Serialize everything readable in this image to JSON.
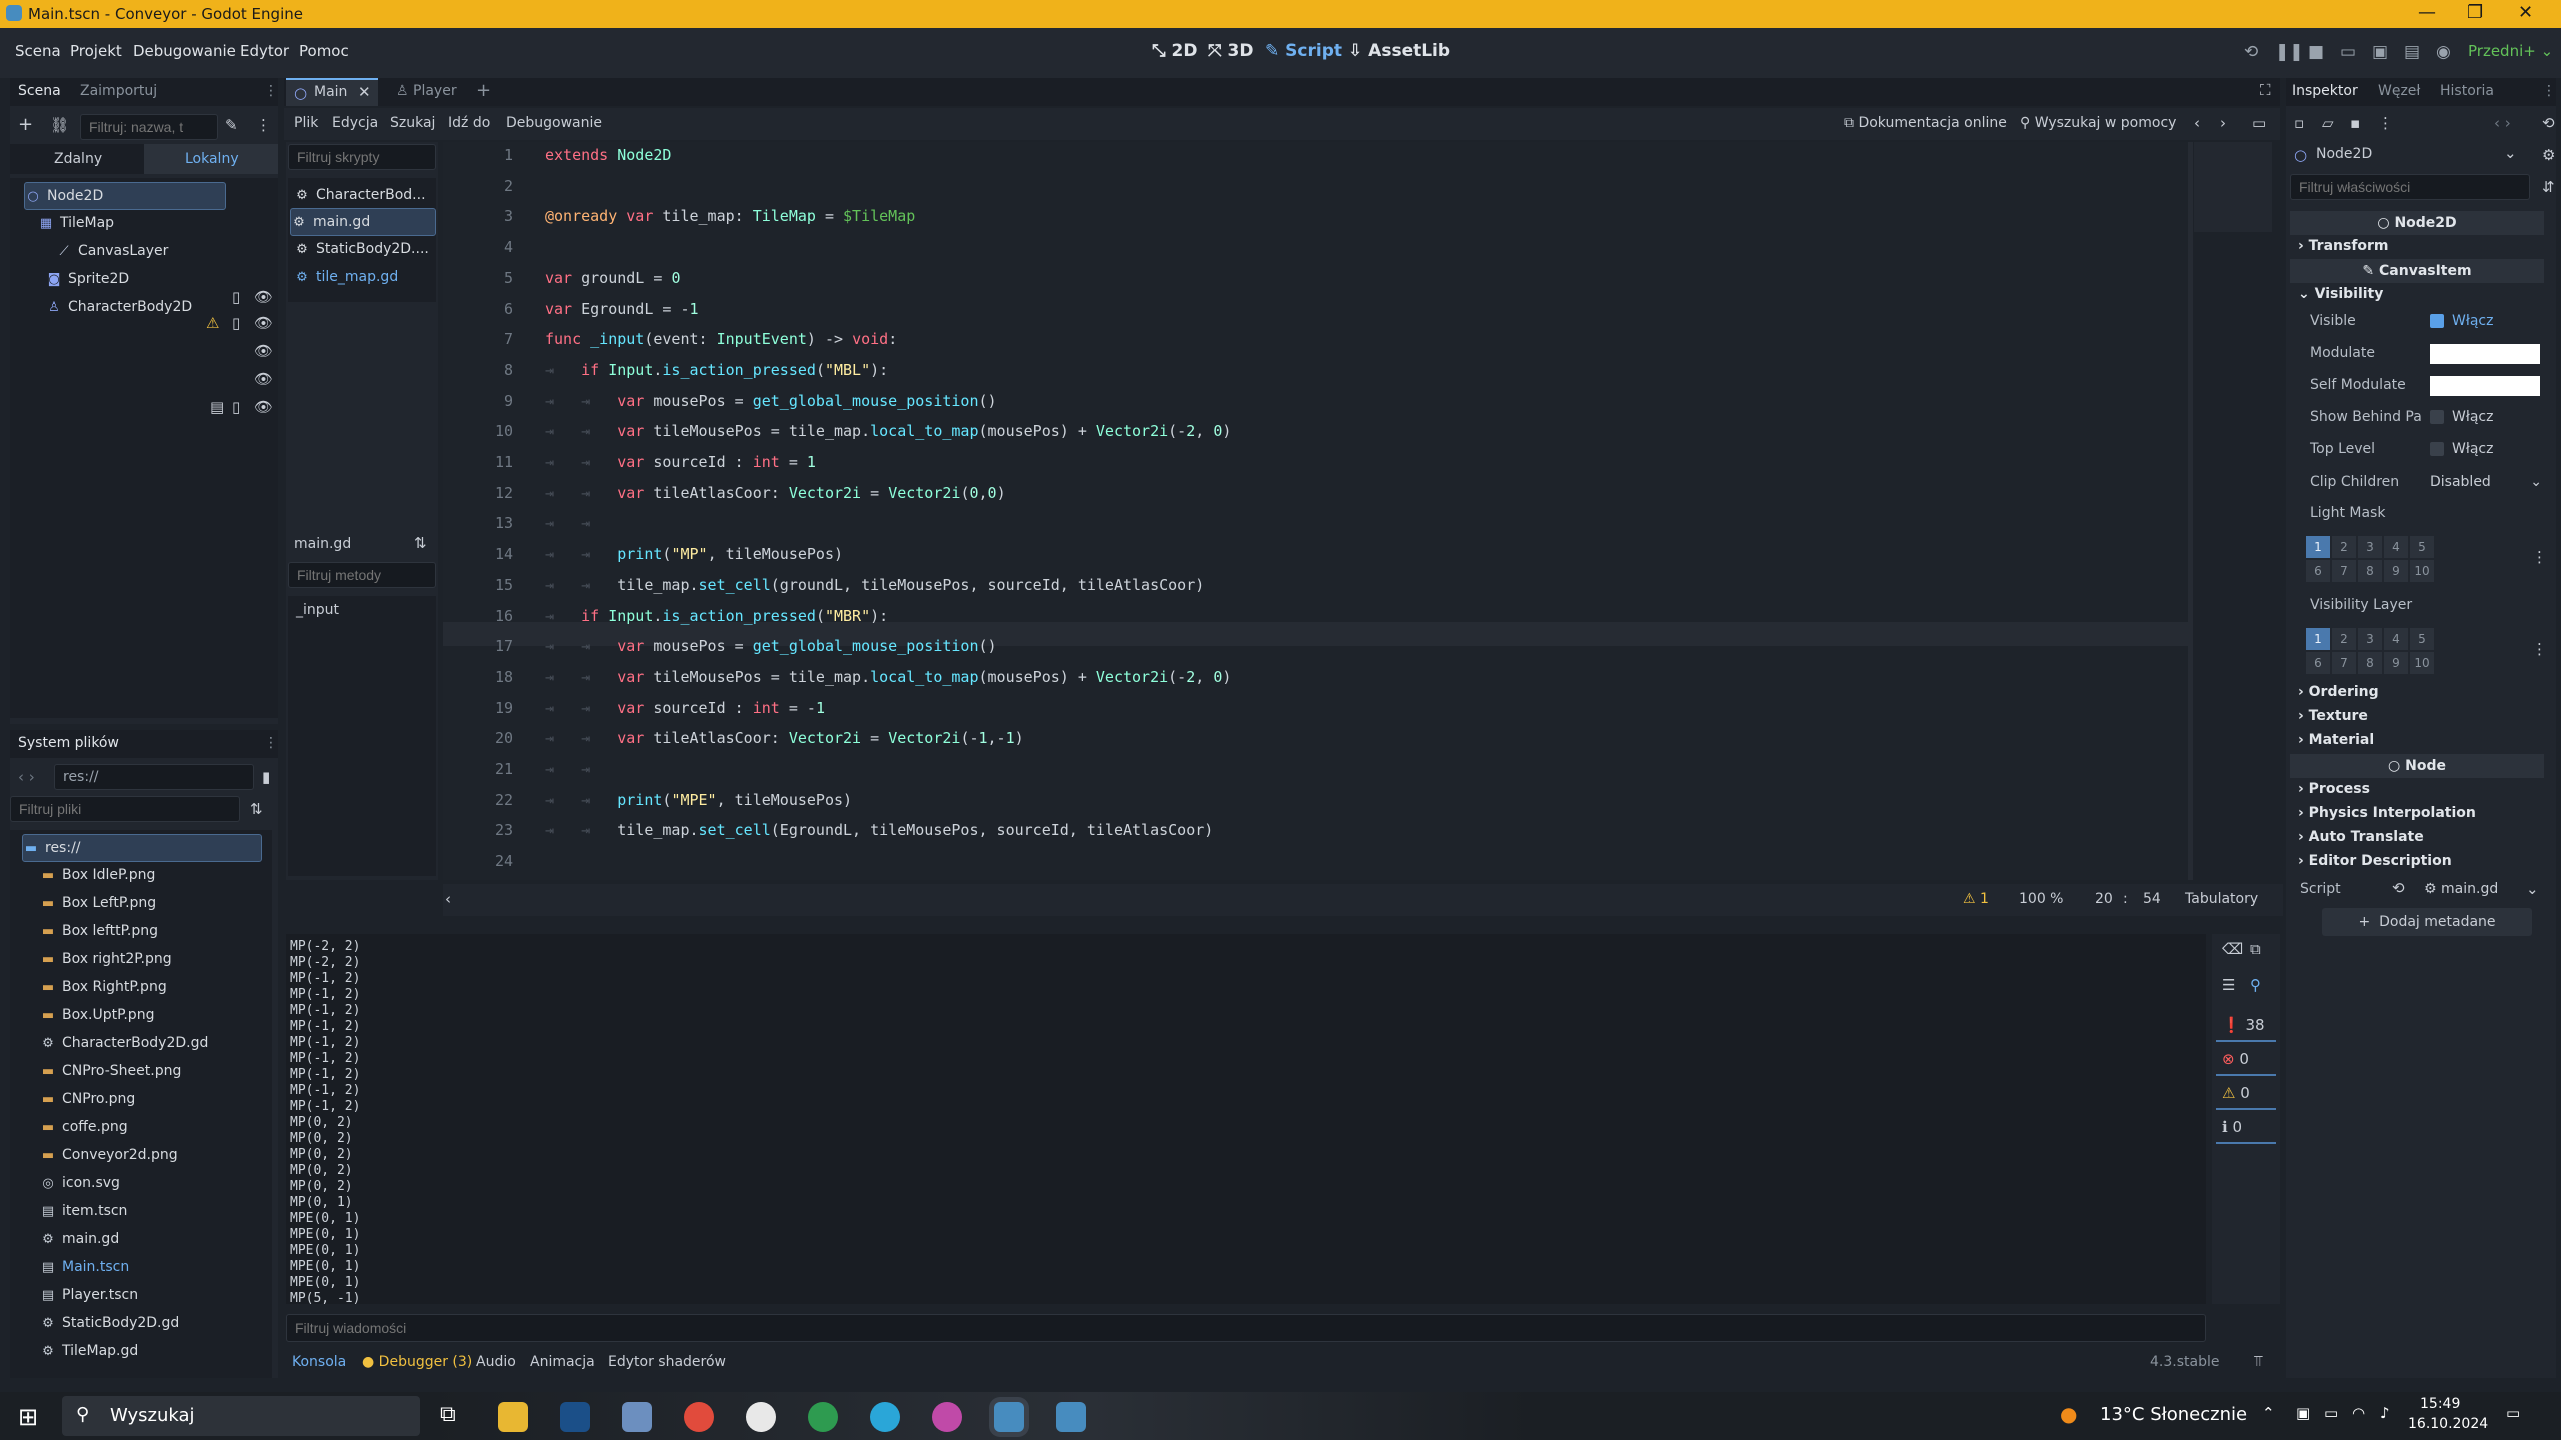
{
  "window": {
    "title": "Main.tscn - Conveyor - Godot Engine",
    "controls": [
      "—",
      "❐",
      "✕"
    ]
  },
  "menu": {
    "items": [
      "Scena",
      "Projekt",
      "Debugowanie",
      "Edytor",
      "Pomoc"
    ],
    "workspaces": [
      "2D",
      "3D",
      "Script",
      "AssetLib"
    ],
    "renderer": "Przedni+"
  },
  "scene_dock": {
    "tabs": [
      "Scena",
      "Zaimportuj"
    ],
    "filter_placeholder": "Filtruj: nazwa, t",
    "subtabs": [
      "Zdalny",
      "Lokalny"
    ],
    "nodes": [
      "Node2D",
      "TileMap",
      "CanvasLayer",
      "Sprite2D",
      "CharacterBody2D"
    ]
  },
  "filesystem": {
    "tab": "System plików",
    "path": "res://",
    "filter_placeholder": "Filtruj pliki",
    "root": "res://",
    "files": [
      "Box IdleP.png",
      "Box LeftP.png",
      "Box lefttP.png",
      "Box right2P.png",
      "Box RightP.png",
      "Box.UptP.png",
      "CharacterBody2D.gd",
      "CNPro-Sheet.png",
      "CNPro.png",
      "coffe.png",
      "Conveyor2d.png",
      "icon.svg",
      "item.tscn",
      "main.gd",
      "Main.tscn",
      "Player.tscn",
      "StaticBody2D.gd",
      "TileMap.gd"
    ]
  },
  "editor_tabs": {
    "tabs": [
      "Main",
      "Player"
    ]
  },
  "script_menu": {
    "items": [
      "Plik",
      "Edycja",
      "Szukaj",
      "Idź do",
      "Debugowanie"
    ],
    "docs": "Dokumentacja online",
    "help": "Wyszukaj w pomocy"
  },
  "script_list": {
    "filter_placeholder": "Filtruj skrypty",
    "scripts": [
      "CharacterBod...",
      "main.gd",
      "StaticBody2D....",
      "tile_map.gd"
    ],
    "current": "main.gd",
    "method_filter": "Filtruj metody",
    "methods": [
      "_input"
    ]
  },
  "code": {
    "lines": [
      "extends Node2D",
      "",
      "@onready var tile_map: TileMap = $TileMap",
      "",
      "var groundL = 0",
      "var EgroundL = -1",
      "func _input(event: InputEvent) -> void:",
      "\tif Input.is_action_pressed(\"MBL\"):",
      "\t\tvar mousePos = get_global_mouse_position()",
      "\t\tvar tileMousePos = tile_map.local_to_map(mousePos) + Vector2i(-2, 0)",
      "\t\tvar sourceId : int = 1",
      "\t\tvar tileAtlasCoor: Vector2i = Vector2i(0,0)",
      "\t\t",
      "\t\tprint(\"MP\", tileMousePos)",
      "\t\ttile_map.set_cell(groundL, tileMousePos, sourceId, tileAtlasCoor)",
      "\tif Input.is_action_pressed(\"MBR\"):",
      "\t\tvar mousePos = get_global_mouse_position()",
      "\t\tvar tileMousePos = tile_map.local_to_map(mousePos) + Vector2i(-2, 0)",
      "\t\tvar sourceId : int = -1",
      "\t\tvar tileAtlasCoor: Vector2i = Vector2i(-1,-1)",
      "\t\t",
      "\t\tprint(\"MPE\", tileMousePos)",
      "\t\ttile_map.set_cell(EgroundL, tileMousePos, sourceId, tileAtlasCoor)",
      ""
    ]
  },
  "status": {
    "warnings": "1",
    "zoom": "100 %",
    "line": "20",
    "col": "54",
    "indent": "Tabulatory"
  },
  "output": {
    "lines": [
      "MP(-2, 2)",
      "MP(-2, 2)",
      "MP(-1, 2)",
      "MP(-1, 2)",
      "MP(-1, 2)",
      "MP(-1, 2)",
      "MP(-1, 2)",
      "MP(-1, 2)",
      "MP(-1, 2)",
      "MP(-1, 2)",
      "MP(-1, 2)",
      "MP(0, 2)",
      "MP(0, 2)",
      "MP(0, 2)",
      "MP(0, 2)",
      "MP(0, 2)",
      "MP(0, 1)",
      "MPE(0, 1)",
      "MPE(0, 1)",
      "MPE(0, 1)",
      "MPE(0, 1)",
      "MPE(0, 1)",
      "MP(5, -1)"
    ],
    "filter_placeholder": "Filtruj wiadomości",
    "counts": {
      "messages": "38",
      "errors": "0",
      "warnings": "0",
      "info": "0"
    }
  },
  "bottom_tabs": {
    "tabs": [
      "Konsola",
      "Debugger (3)",
      "Audio",
      "Animacja",
      "Edytor shaderów"
    ],
    "version": "4.3.stable"
  },
  "inspector": {
    "tabs": [
      "Inspektor",
      "Węzeł",
      "Historia"
    ],
    "node": "Node2D",
    "filter_placeholder": "Filtruj właściwości",
    "class1": "Node2D",
    "transform": "Transform",
    "class2": "CanvasItem",
    "visibility": "Visibility",
    "props": {
      "visible": "Visible",
      "visible_val": "Włącz",
      "modulate": "Modulate",
      "self_modulate": "Self Modulate",
      "show_behind": "Show Behind Pa",
      "show_behind_val": "Włącz",
      "top_level": "Top Level",
      "top_level_val": "Włącz",
      "clip_children": "Clip Children",
      "clip_val": "Disabled",
      "light_mask": "Light Mask",
      "vis_layer": "Visibility Layer"
    },
    "mask_bits": [
      "1",
      "2",
      "3",
      "4",
      "5",
      "6",
      "7",
      "8",
      "9",
      "10"
    ],
    "sections": [
      "Ordering",
      "Texture",
      "Material"
    ],
    "class3": "Node",
    "sections2": [
      "Process",
      "Physics Interpolation",
      "Auto Translate",
      "Editor Description"
    ],
    "script_label": "Script",
    "script_val": "main.gd",
    "add_meta": "Dodaj metadane",
    "colors": {
      "modulate": "#ffffff",
      "accent": "#5aa0e8"
    }
  },
  "taskbar": {
    "search": "Wyszukaj",
    "weather": "13°C Słonecznie",
    "time": "15:49",
    "date": "16.10.2024"
  }
}
